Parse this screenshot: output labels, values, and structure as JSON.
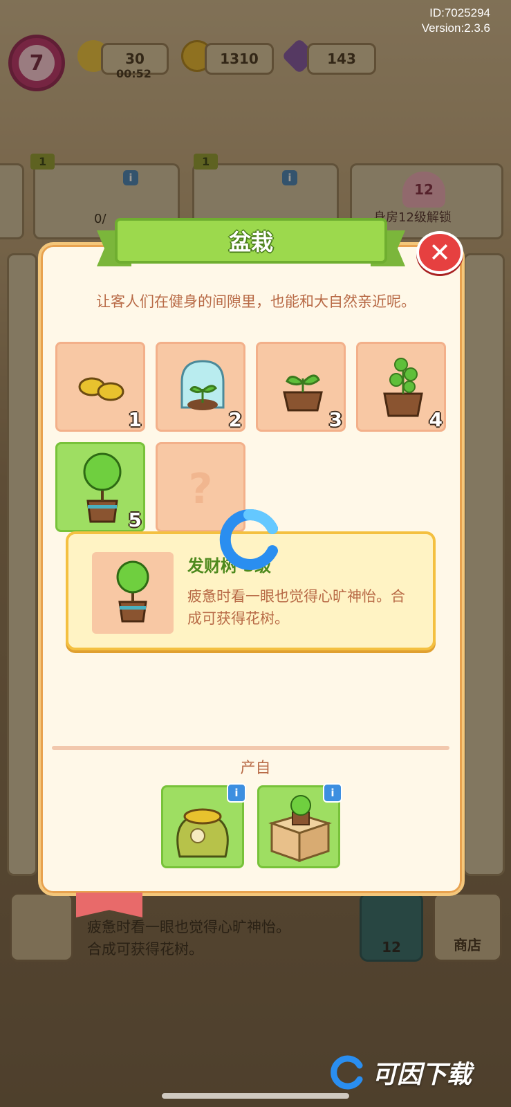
{
  "header": {
    "id_text": "ID:7025294",
    "version_text": "Version:2.3.6",
    "level": "7",
    "energy": "30",
    "energy_timer": "00:52",
    "coins": "1310",
    "gems": "143"
  },
  "background": {
    "badge_1": "1",
    "badge_2": "1",
    "progress_text": "0/",
    "heart_level": "12",
    "unlock_text": "身房12级解锁",
    "bottom_text_line1": "疲惫时看一眼也觉得心旷神怡。",
    "bottom_text_line2": "合成可获得花树。",
    "coin_button_value": "12",
    "shop_label": "商店"
  },
  "modal": {
    "title": "盆栽",
    "close_symbol": "✕",
    "description": "让客人们在健身的间隙里，也能和大自然亲近呢。",
    "items": [
      {
        "level": "1",
        "icon": "seeds-icon",
        "selected": false
      },
      {
        "level": "2",
        "icon": "sprout-in-jar-icon",
        "selected": false
      },
      {
        "level": "3",
        "icon": "sprout-pot-icon",
        "selected": false
      },
      {
        "level": "4",
        "icon": "young-plant-pot-icon",
        "selected": false
      },
      {
        "level": "5",
        "icon": "money-tree-pot-icon",
        "selected": true
      },
      {
        "level": "",
        "icon": "question-mark-icon",
        "selected": false
      }
    ],
    "unknown_symbol": "?",
    "detail": {
      "name": "发财树 5级",
      "description": "疲惫时看一眼也觉得心旷神怡。合成可获得花树。"
    },
    "source_label": "产自",
    "sources": [
      {
        "icon": "seed-sack-icon",
        "info": "i"
      },
      {
        "icon": "plant-box-icon",
        "info": "i"
      }
    ]
  },
  "watermark": {
    "text": "可因下载"
  },
  "colors": {
    "banner_green": "#9cd94d",
    "cell_peach": "#f8c8a4",
    "cell_selected": "#9ede62",
    "text_brown": "#b86a46",
    "close_red": "#e64040"
  }
}
